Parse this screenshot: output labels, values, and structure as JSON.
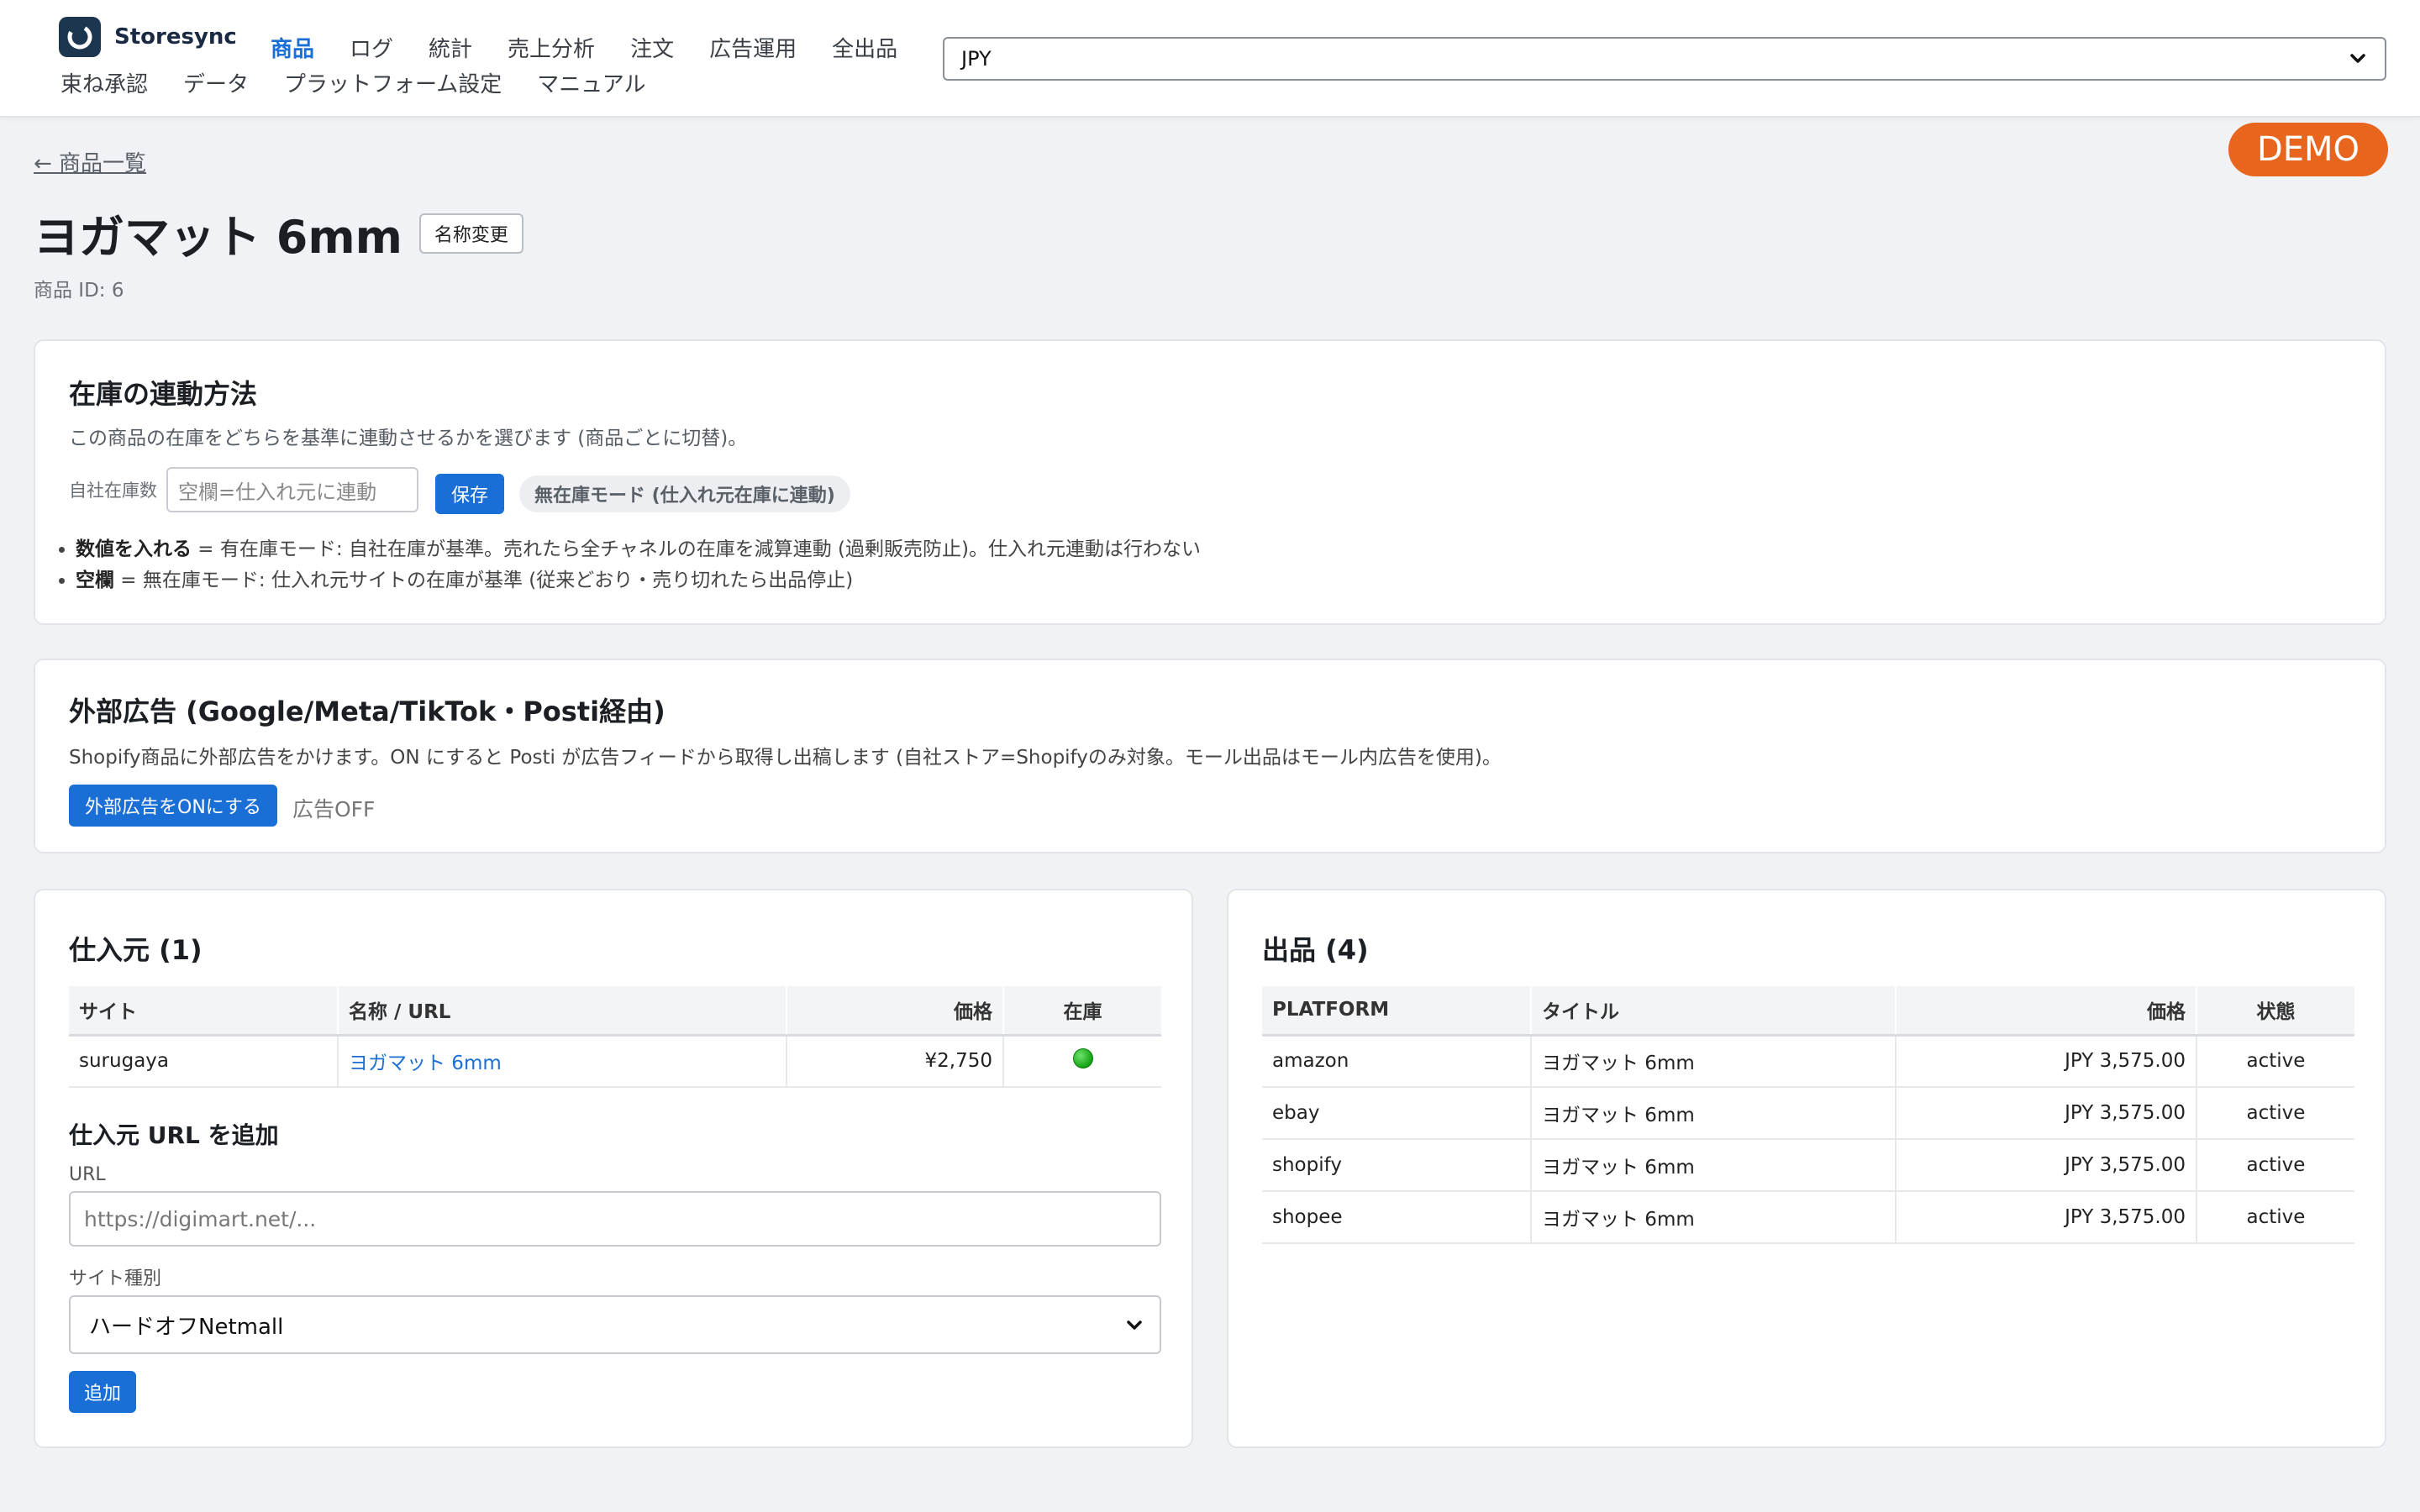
{
  "brand": {
    "name": "Storesync"
  },
  "nav": {
    "row1": [
      "商品",
      "ログ",
      "統計",
      "売上分析",
      "注文",
      "広告運用",
      "全出品"
    ],
    "row2": [
      "束ね承認",
      "データ",
      "プラットフォーム設定",
      "マニュアル"
    ],
    "active": "商品"
  },
  "currency": {
    "selected": "JPY"
  },
  "demo_badge": "DEMO",
  "back_link": "← 商品一覧",
  "product": {
    "title": "ヨガマット 6mm",
    "rename_label": "名称変更",
    "id_label": "商品 ID: 6"
  },
  "stock_card": {
    "title": "在庫の連動方法",
    "description": "この商品の在庫をどちらを基準に連動させるかを選びます (商品ごとに切替)。",
    "input_label": "自社在庫数",
    "input_placeholder": "空欄=仕入れ元に連動",
    "save_label": "保存",
    "mode_pill": "無在庫モード (仕入れ元在庫に連動)",
    "bullet1_bold": "数値を入れる",
    "bullet1_text": " = 有在庫モード: 自社在庫が基準。売れたら全チャネルの在庫を減算連動 (過剰販売防止)。仕入れ元連動は行わない",
    "bullet2_bold": "空欄",
    "bullet2_text": " = 無在庫モード: 仕入れ元サイトの在庫が基準 (従来どおり・売り切れたら出品停止)"
  },
  "ads_card": {
    "title": "外部広告 (Google/Meta/TikTok・Posti経由)",
    "description": "Shopify商品に外部広告をかけます。ON にすると Posti が広告フィードから取得し出稿します (自社ストア=Shopifyのみ対象。モール出品はモール内広告を使用)。",
    "button_label": "外部広告をONにする",
    "status": "広告OFF"
  },
  "sources_card": {
    "title": "仕入元 (1)",
    "headers": [
      "サイト",
      "名称 / URL",
      "価格",
      "在庫"
    ],
    "rows": [
      {
        "site": "surugaya",
        "name": "ヨガマット 6mm",
        "price": "¥2,750"
      }
    ],
    "add_title": "仕入元 URL を追加",
    "url_label": "URL",
    "url_placeholder": "https://digimart.net/...",
    "site_type_label": "サイト種別",
    "site_type_selected": "ハードオフNetmall",
    "add_button": "追加"
  },
  "listings_card": {
    "title": "出品 (4)",
    "headers": [
      "PLATFORM",
      "タイトル",
      "価格",
      "状態"
    ],
    "rows": [
      {
        "platform": "amazon",
        "title": "ヨガマット 6mm",
        "price": "JPY 3,575.00",
        "status": "active"
      },
      {
        "platform": "ebay",
        "title": "ヨガマット 6mm",
        "price": "JPY 3,575.00",
        "status": "active"
      },
      {
        "platform": "shopify",
        "title": "ヨガマット 6mm",
        "price": "JPY 3,575.00",
        "status": "active"
      },
      {
        "platform": "shopee",
        "title": "ヨガマット 6mm",
        "price": "JPY 3,575.00",
        "status": "active"
      }
    ]
  }
}
